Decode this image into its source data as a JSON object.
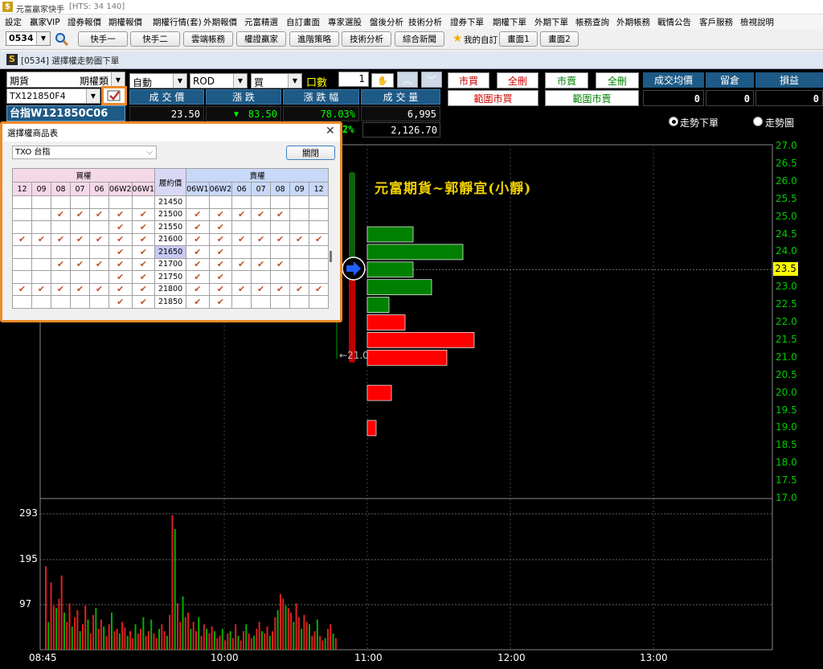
{
  "window": {
    "app_title": "元富贏家快手",
    "server": "[HTS: 34 140]"
  },
  "menu": [
    "設定",
    "贏家VIP",
    "證券報價",
    "期權報價",
    "期權行情(套)",
    "外期報價",
    "元富精選",
    "自訂畫面",
    "專家選股",
    "盤後分析",
    "技術分析",
    "證券下單",
    "期權下單",
    "外期下單",
    "帳務查詢",
    "外期帳務",
    "戰情公告",
    "客戶服務",
    "檢視說明"
  ],
  "toolbar": {
    "code_value": "0534",
    "buttons": [
      "快手一",
      "快手二",
      "雲端帳務",
      "權證贏家",
      "進階策略",
      "技術分析",
      "綜合新聞"
    ],
    "my_custom": "我的自訂",
    "screens": [
      "畫面1",
      "畫面2"
    ]
  },
  "doc": {
    "title": "[0534] 選擇權走勢圖下單"
  },
  "order": {
    "product_type": "期貨",
    "product_class": "期權類",
    "contract": "TX121850F4",
    "option_name": "台指W121850C06",
    "mode": "自動",
    "tif": "ROD",
    "side": "買",
    "qty_label": "口數",
    "qty": "1",
    "btn_market_buy": "市買",
    "btn_cancel_all_1": "全刪",
    "btn_market_sell": "市賣",
    "btn_cancel_all_2": "全刪",
    "btn_range_buy": "範圍市買",
    "btn_range_sell": "範圍市賣",
    "quote_headers": [
      "成 交 價",
      "漲   跌",
      "漲 跌 幅",
      "成 交 量"
    ],
    "quote_values": [
      "23.50",
      "83.50",
      "78.03%",
      "6,995"
    ],
    "quote_row2_pct": "2%",
    "quote_row2_vol": "2,126.70",
    "pos_headers": [
      "成交均價",
      "留倉",
      "損益"
    ],
    "pos_values": [
      "0",
      "0",
      "0"
    ],
    "radio_trend_order": "走勢下單",
    "radio_trend_chart": "走勢圖"
  },
  "chart": {
    "watermark": "元富期貨~郭靜宜(小靜)",
    "price_label": "23.5",
    "low_marker": "21.0",
    "y_ticks": [
      "27.0",
      "26.5",
      "26.0",
      "25.5",
      "25.0",
      "24.5",
      "24.0",
      "23.5",
      "23.0",
      "22.5",
      "22.0",
      "21.5",
      "21.0",
      "20.5",
      "20.0",
      "19.5",
      "19.0",
      "18.5",
      "18.0",
      "17.5",
      "17.0"
    ],
    "vol_ticks": [
      "293",
      "195",
      "97"
    ],
    "x_ticks": [
      "08:45",
      "10:00",
      "11:00",
      "12:00",
      "13:00"
    ],
    "colors": {
      "up": "#ff0000",
      "down": "#008000",
      "axis": "#00cc00"
    }
  },
  "dialog": {
    "title": "選擇權商品表",
    "underlying": "TXO 台指",
    "close_btn": "關閉",
    "call_header": "買權",
    "strike_header": "履約價",
    "put_header": "賣權",
    "call_cols": [
      "12",
      "09",
      "08",
      "07",
      "06",
      "06W2",
      "06W1"
    ],
    "put_cols": [
      "06W1",
      "06W2",
      "06",
      "07",
      "08",
      "09",
      "12"
    ],
    "strikes": [
      "21450",
      "21500",
      "21550",
      "21600",
      "21650",
      "21700",
      "21750",
      "21800",
      "21850"
    ]
  }
}
